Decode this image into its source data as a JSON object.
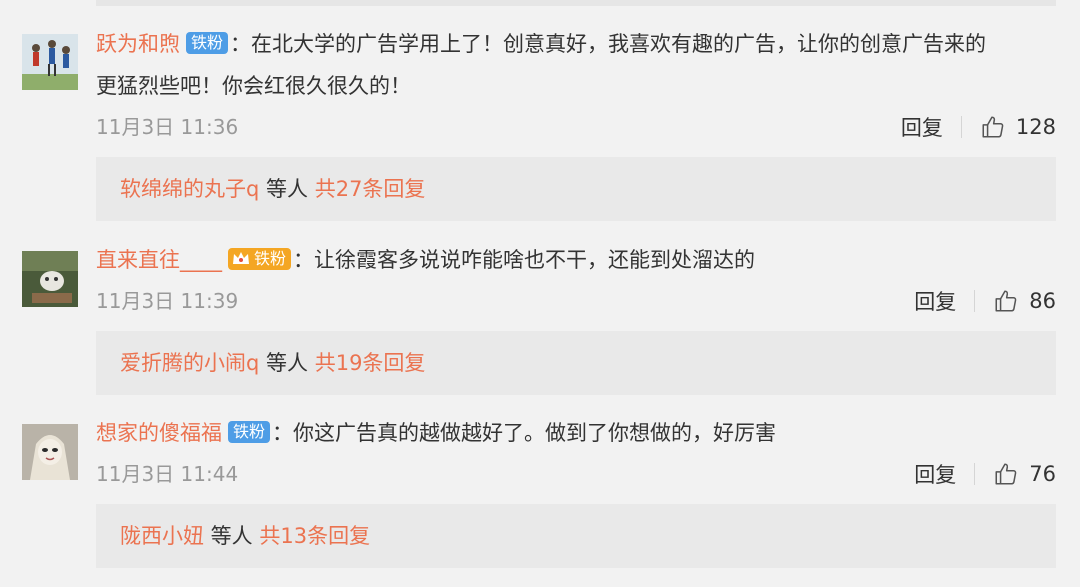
{
  "comments": [
    {
      "username": "跃为和煦",
      "badge": "铁粉",
      "colon": "：",
      "text_line1": "在北大学的广告学用上了！创意真好，我喜欢有趣的广告，让你的创意广告来的",
      "text_line2": "更猛烈些吧！你会红很久很久的！",
      "time": "11月3日 11:36",
      "reply_label": "回复",
      "likes": "128",
      "reply_preview": {
        "user": "软绵绵的丸子q",
        "mid": " 等人 ",
        "total": "共27条回复"
      }
    },
    {
      "username": "直来直往____",
      "badge": "铁粉",
      "colon": "：",
      "text_line1": "让徐霞客多说说咋能啥也不干，还能到处溜达的",
      "time": "11月3日 11:39",
      "reply_label": "回复",
      "likes": "86",
      "reply_preview": {
        "user": "爱折腾的小闹q",
        "mid": " 等人 ",
        "total": "共19条回复"
      }
    },
    {
      "username": "想家的傻福福",
      "badge": "铁粉",
      "colon": "：",
      "text_line1": "你这广告真的越做越好了。做到了你想做的，好厉害",
      "time": "11月3日 11:44",
      "reply_label": "回复",
      "likes": "76",
      "reply_preview": {
        "user": "陇西小妞",
        "mid": " 等人 ",
        "total": "共13条回复"
      }
    }
  ],
  "colors": {
    "username": "#eb7350",
    "badge_blue": "#4e9de6",
    "badge_gold": "#f4a623",
    "reply_box": "#e9e9e9",
    "background": "#f2f2f2"
  },
  "icons": [
    "avatar",
    "thumbs-up-icon",
    "crown-icon"
  ]
}
